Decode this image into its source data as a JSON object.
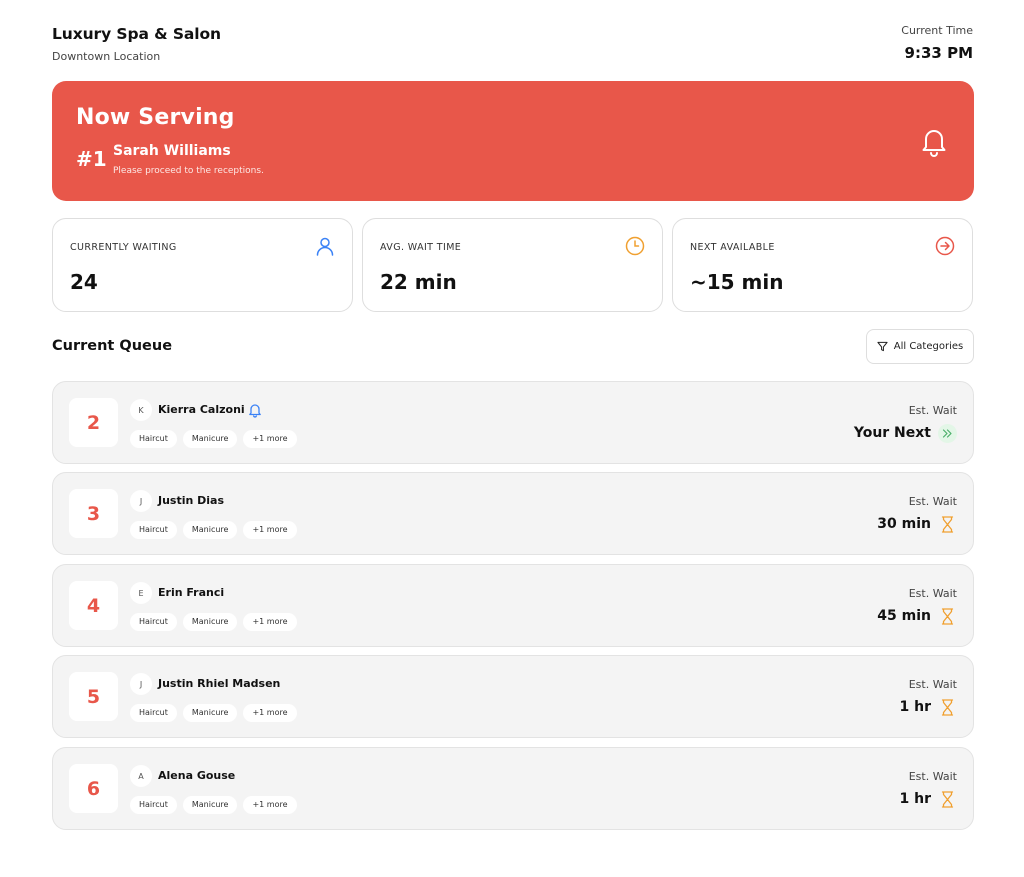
{
  "header": {
    "title": "Luxury Spa & Salon",
    "subtitle": "Downtown Location",
    "time_label": "Current Time",
    "time_value": "9:33 PM"
  },
  "now_serving": {
    "heading": "Now Serving",
    "number": "#1",
    "name": "Sarah Williams",
    "message": "Please proceed to the receptions.",
    "icon": "bell-icon",
    "color": "#e8574a"
  },
  "stats": [
    {
      "label": "CURRENTLY WAITING",
      "value": "24",
      "icon": "user-icon",
      "icon_color": "#3b82f6"
    },
    {
      "label": "AVG. WAIT TIME",
      "value": "22 min",
      "icon": "clock-icon",
      "icon_color": "#f0a030"
    },
    {
      "label": "NEXT AVAILABLE",
      "value": "~15 min",
      "icon": "arrow-right-circle-icon",
      "icon_color": "#e8574a"
    }
  ],
  "queue": {
    "title": "Current Queue",
    "filter_label": "All Categories",
    "wait_label": "Est. Wait",
    "rows": [
      {
        "number": "2",
        "initial": "K",
        "name": "Kierra Calzoni",
        "tags": [
          "Haircut",
          "Manicure",
          "+1 more"
        ],
        "wait": "Your Next",
        "wait_icon": "chevrons-right-icon",
        "notify": true
      },
      {
        "number": "3",
        "initial": "J",
        "name": "Justin Dias",
        "tags": [
          "Haircut",
          "Manicure",
          "+1 more"
        ],
        "wait": "30 min",
        "wait_icon": "hourglass-icon",
        "notify": false
      },
      {
        "number": "4",
        "initial": "E",
        "name": "Erin Franci",
        "tags": [
          "Haircut",
          "Manicure",
          "+1 more"
        ],
        "wait": "45 min",
        "wait_icon": "hourglass-icon",
        "notify": false
      },
      {
        "number": "5",
        "initial": "J",
        "name": "Justin Rhiel Madsen",
        "tags": [
          "Haircut",
          "Manicure",
          "+1 more"
        ],
        "wait": "1 hr",
        "wait_icon": "hourglass-icon",
        "notify": false
      },
      {
        "number": "6",
        "initial": "A",
        "name": "Alena Gouse",
        "tags": [
          "Haircut",
          "Manicure",
          "+1 more"
        ],
        "wait": "1 hr",
        "wait_icon": "hourglass-icon",
        "notify": false
      }
    ]
  }
}
